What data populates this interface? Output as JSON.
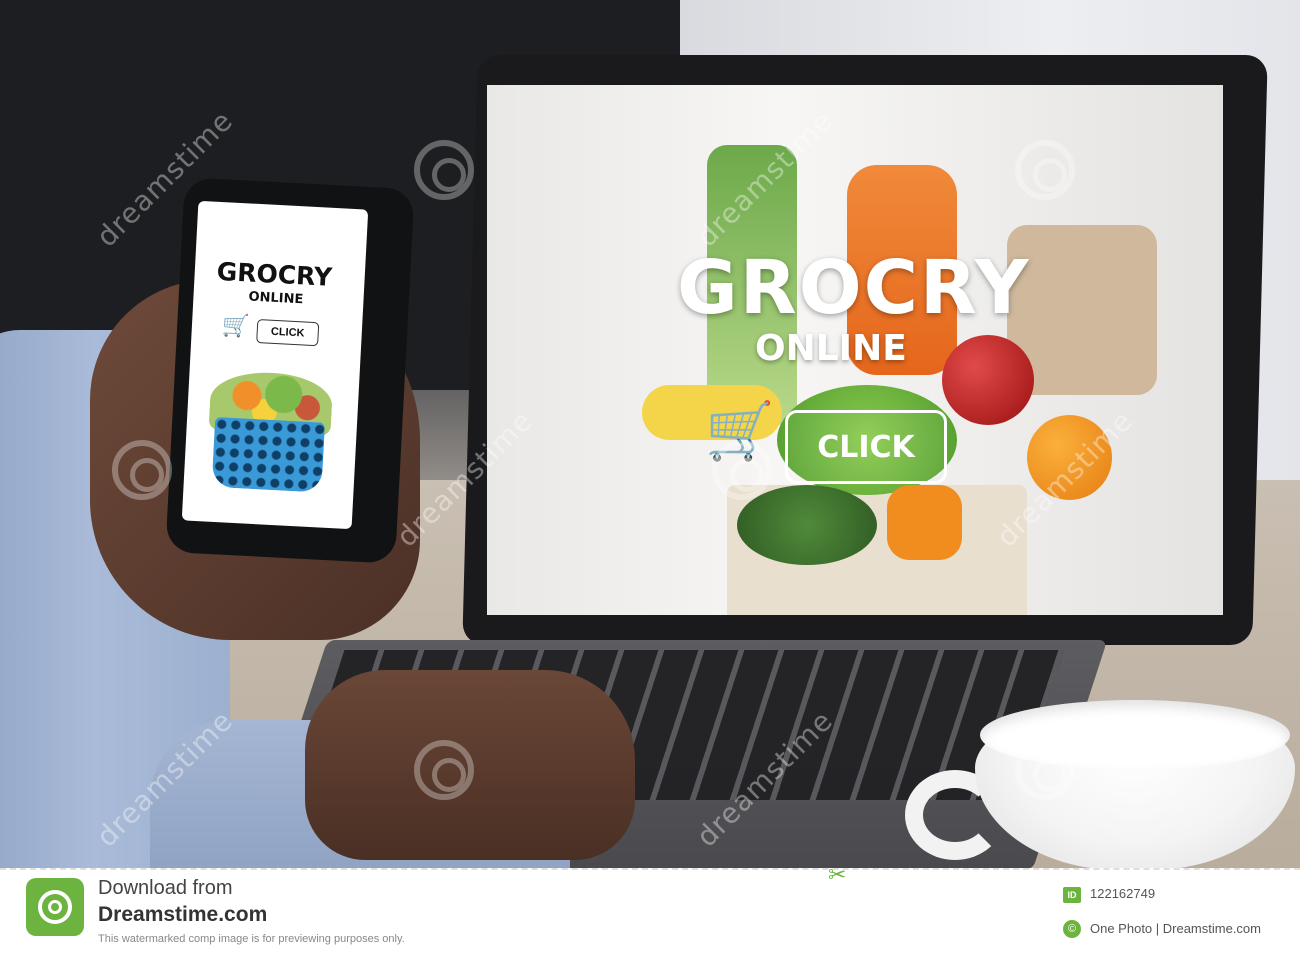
{
  "laptop_screen": {
    "title": "GROCRY",
    "subtitle": "ONLINE",
    "button_label": "CLICK"
  },
  "phone_screen": {
    "title": "GROCRY",
    "subtitle": "ONLINE",
    "button_label": "CLICK"
  },
  "watermark": {
    "text": "dreamstime"
  },
  "footer": {
    "line1": "Download from",
    "line2": "Dreamstime.com",
    "line3": "This watermarked comp image is for previewing purposes only.",
    "id_badge": "ID",
    "image_id": "122162749",
    "credit": "One Photo | Dreamstime.com",
    "brand_color": "#6cb33f"
  },
  "icons": [
    "cart-icon",
    "scissors-icon",
    "dreamstime-logo-icon",
    "copyright-icon"
  ]
}
